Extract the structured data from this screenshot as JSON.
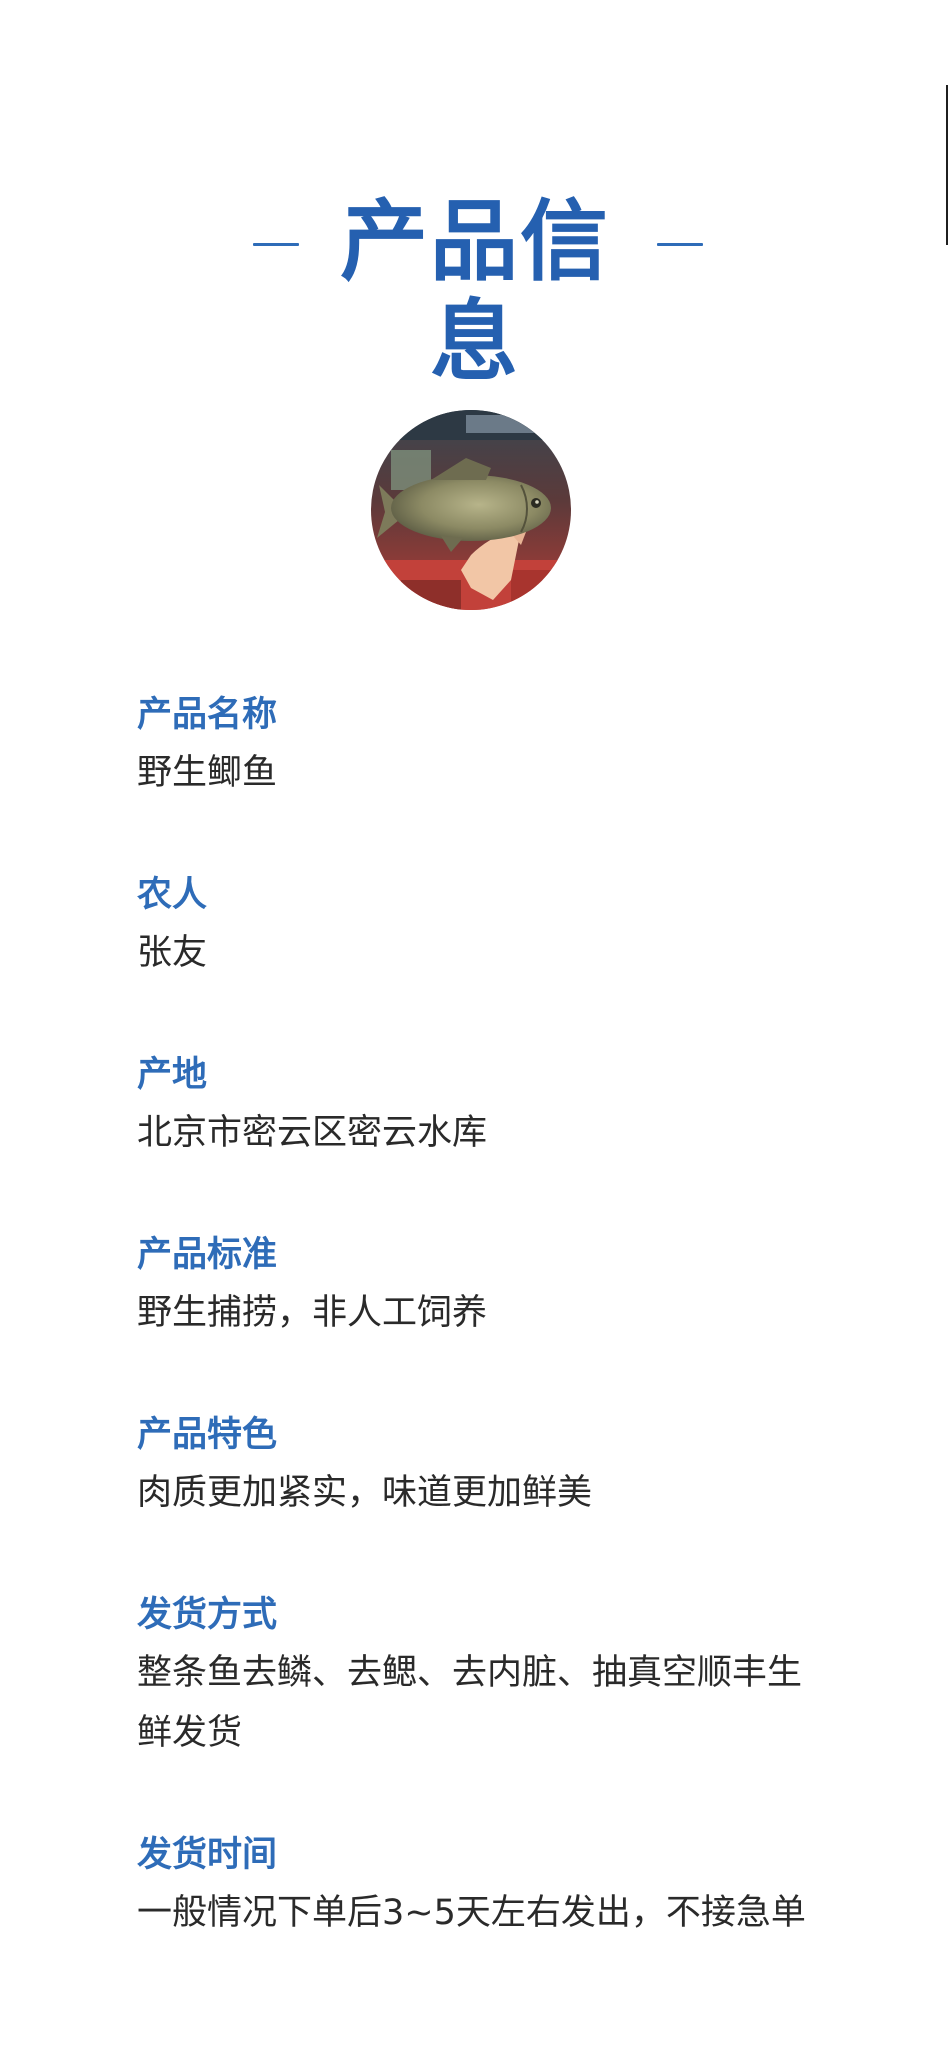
{
  "header": {
    "title": "产品信息"
  },
  "product_image": {
    "icon": "fish-photo"
  },
  "details": [
    {
      "label": "产品名称",
      "value": "野生鲫鱼"
    },
    {
      "label": "农人",
      "value": "张友"
    },
    {
      "label": "产地",
      "value": "北京市密云区密云水库"
    },
    {
      "label": "产品标准",
      "value": "野生捕捞，非人工饲养"
    },
    {
      "label": "产品特色",
      "value": "肉质更加紧实，味道更加鲜美"
    },
    {
      "label": "发货方式",
      "value": "整条鱼去鳞、去鳃、去内脏、抽真空顺丰生鲜发货"
    },
    {
      "label": "发货时间",
      "value": "一般情况下单后3~5天左右发出，不接急单"
    }
  ],
  "colors": {
    "accent": "#2e6cb8",
    "text": "#2a2a2a",
    "background": "#ffffff"
  }
}
